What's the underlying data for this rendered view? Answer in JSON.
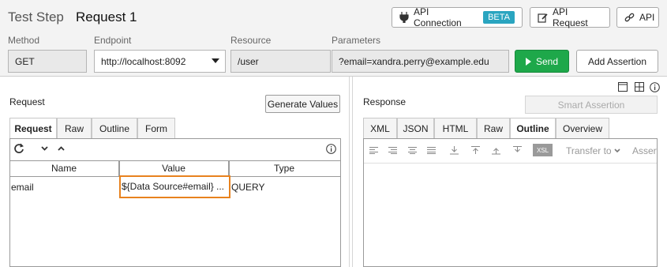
{
  "header": {
    "title_prefix": "Test Step",
    "title_name": "Request 1",
    "api_connection_label": "API Connection",
    "beta_badge": "BETA",
    "api_request_label": "API Request",
    "api_label": "API"
  },
  "fields": {
    "method_label": "Method",
    "method_value": "GET",
    "endpoint_label": "Endpoint",
    "endpoint_value": "http://localhost:8092",
    "resource_label": "Resource",
    "resource_value": "/user",
    "parameters_label": "Parameters",
    "parameters_value": "?email=xandra.perry@example.edu"
  },
  "actions": {
    "send_label": "Send",
    "add_assertion_label": "Add Assertion"
  },
  "request": {
    "section_label": "Request",
    "generate_values_label": "Generate Values",
    "tabs": [
      "Request",
      "Raw",
      "Outline",
      "Form"
    ],
    "active_tab": "Request",
    "columns": [
      "Name",
      "Value",
      "Type"
    ],
    "rows": [
      {
        "name": "email",
        "value": "${Data Source#email}",
        "more": "...",
        "type": "QUERY"
      }
    ]
  },
  "response": {
    "section_label": "Response",
    "smart_assertion_label": "Smart Assertion",
    "tabs": [
      "XML",
      "JSON",
      "HTML",
      "Raw",
      "Outline",
      "Overview"
    ],
    "active_tab": "Outline",
    "transfer_to_label": "Transfer to",
    "assert_label": "Assert",
    "xsl_badge": "XSL"
  },
  "colors": {
    "accent_green": "#1ea84a",
    "beta_blue": "#2aa5c0",
    "highlight_orange": "#e8821e"
  }
}
